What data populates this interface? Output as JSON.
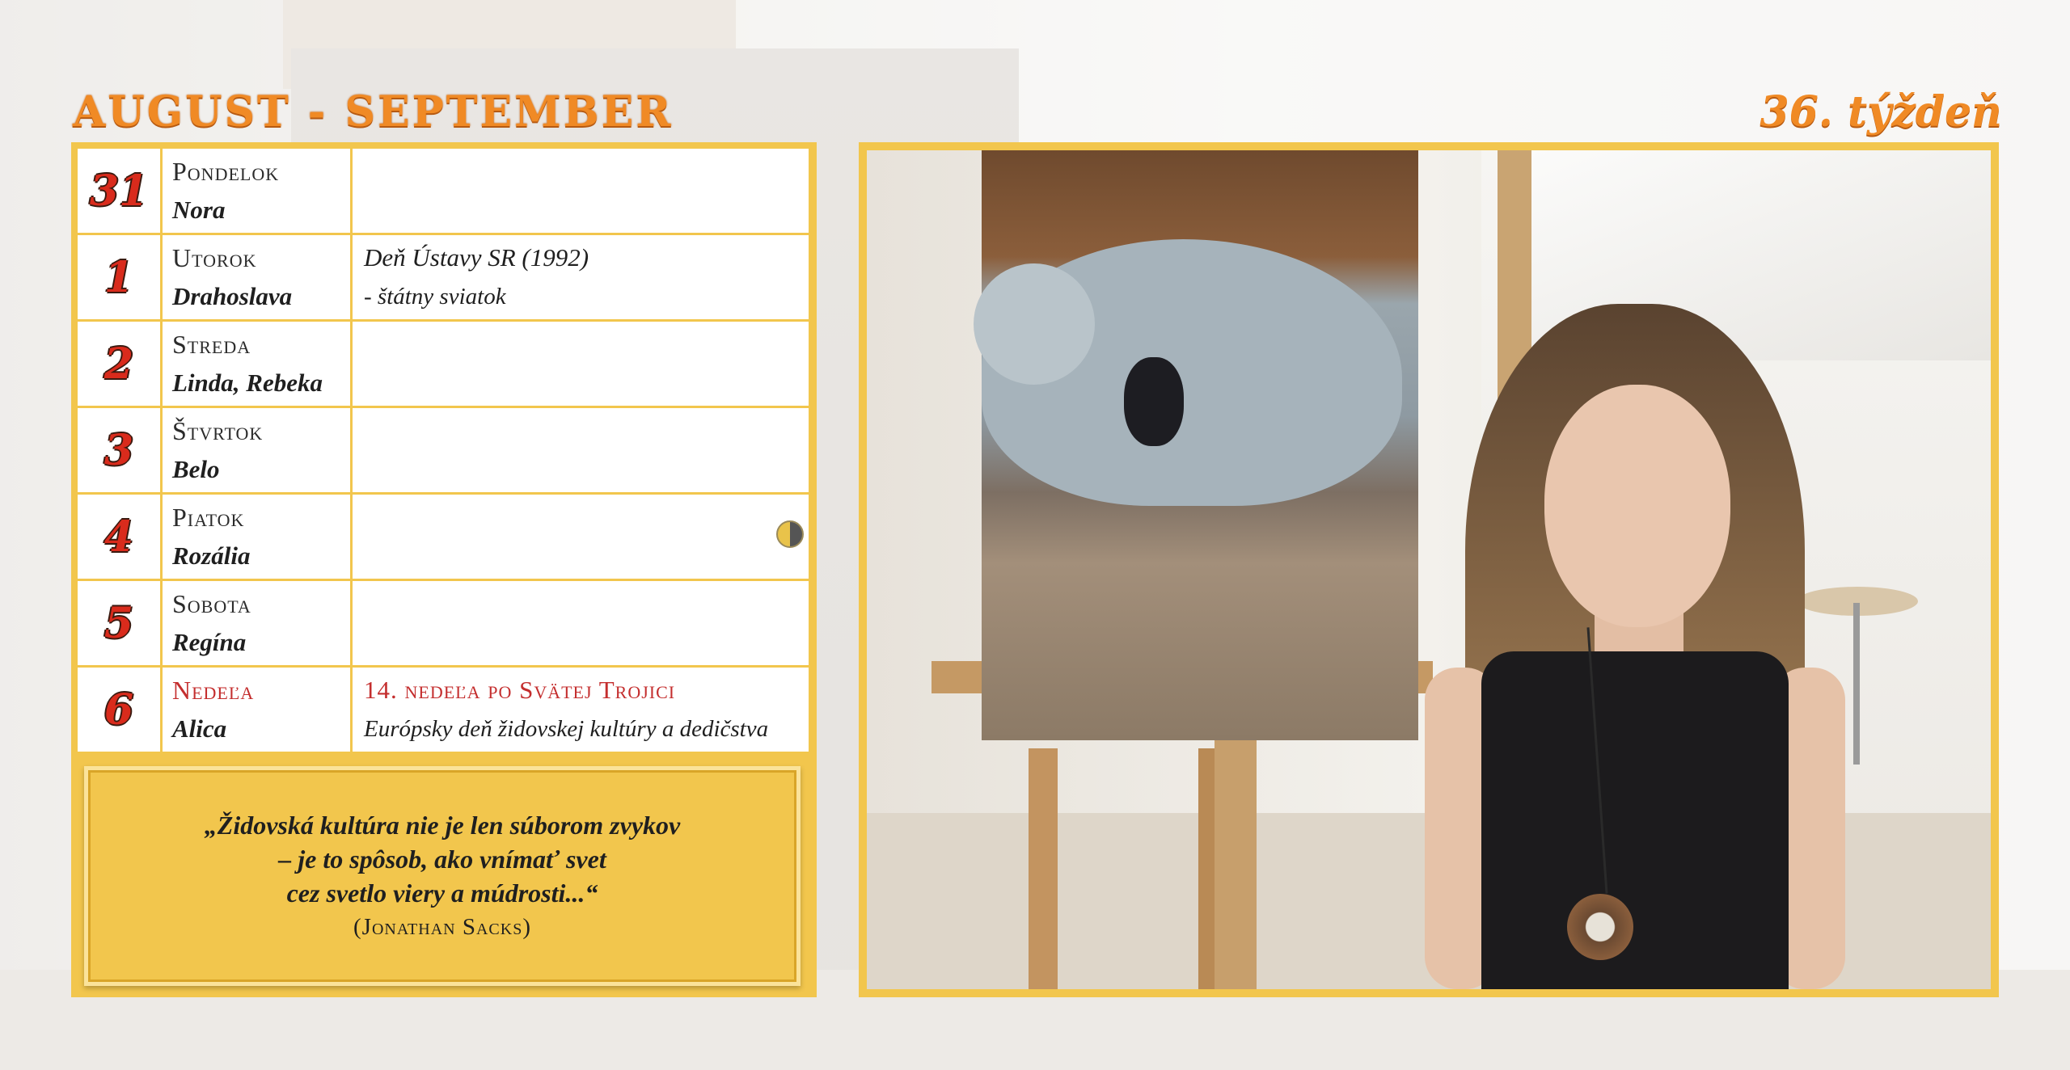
{
  "header": {
    "title": "AUGUST - SEPTEMBER",
    "week": "36. týždeň"
  },
  "days": [
    {
      "num": "31",
      "day": "Pondelok",
      "names": "Nora",
      "note1": "",
      "note2": "",
      "sunday": false,
      "moon": false
    },
    {
      "num": "1",
      "day": "Utorok",
      "names": "Drahoslava",
      "note1": "Deň Ústavy SR (1992)",
      "note2": "- štátny sviatok",
      "sunday": false,
      "moon": false
    },
    {
      "num": "2",
      "day": "Streda",
      "names": "Linda, Rebeka",
      "note1": "",
      "note2": "",
      "sunday": false,
      "moon": false
    },
    {
      "num": "3",
      "day": "Štvrtok",
      "names": "Belo",
      "note1": "",
      "note2": "",
      "sunday": false,
      "moon": false
    },
    {
      "num": "4",
      "day": "Piatok",
      "names": "Rozália",
      "note1": "",
      "note2": "",
      "sunday": false,
      "moon": true
    },
    {
      "num": "5",
      "day": "Sobota",
      "names": "Regína",
      "note1": "",
      "note2": "",
      "sunday": false,
      "moon": false
    },
    {
      "num": "6",
      "day": "Nedeľa",
      "names": "Alica",
      "note1": "14. nedeľa po Svätej Trojici",
      "note2": "Európsky deň židovskej kultúry a dedičstva",
      "sunday": true,
      "moon": false
    }
  ],
  "quote": {
    "lines": [
      "„Židovská kultúra nie je len súborom zvykov",
      "– je to spôsob, ako vnímať svet",
      "cez svetlo viery a múdrosti...“"
    ],
    "author": "(Jonathan Sacks)"
  },
  "icons": {
    "moon": "first-quarter-moon-icon"
  },
  "colors": {
    "accent_orange": "#f08a25",
    "frame_yellow": "#f2c64d",
    "day_number_red": "#d92b1c",
    "sunday_red": "#c42e2e"
  }
}
